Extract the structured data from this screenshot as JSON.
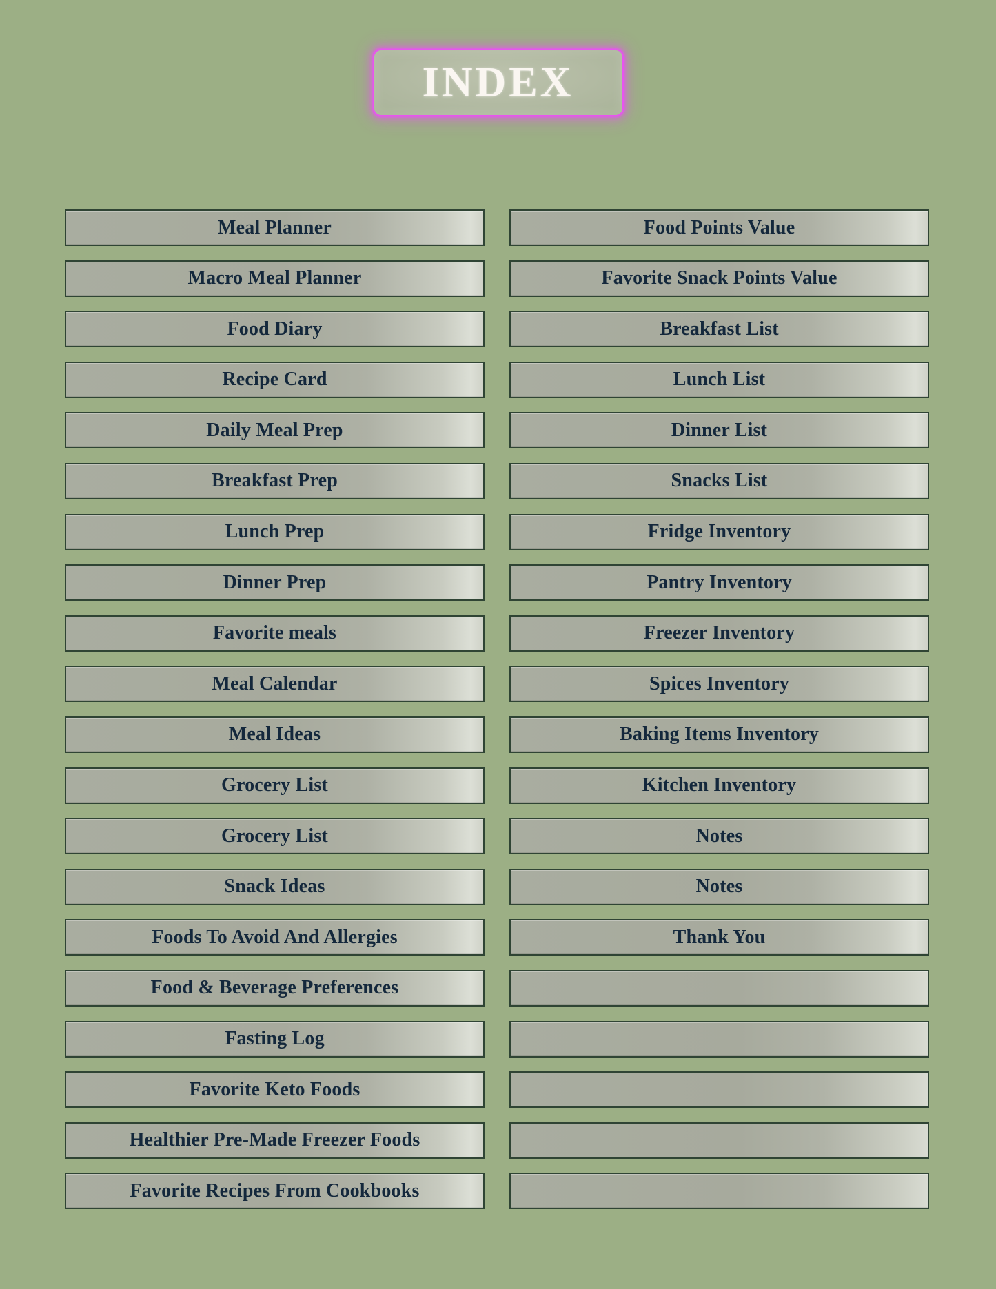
{
  "page": {
    "background_color": "#9caf85",
    "title": "INDEX",
    "title_border_color": "#e854f0",
    "title_text_color": "#faf6f1",
    "entry_fill_color": "#a8ac9c",
    "entry_border_color": "#2f4434",
    "entry_text_color": "#14283c"
  },
  "index": {
    "left_column": [
      {
        "label": "Meal Planner"
      },
      {
        "label": "Macro Meal Planner"
      },
      {
        "label": "Food Diary"
      },
      {
        "label": "Recipe Card"
      },
      {
        "label": "Daily Meal Prep"
      },
      {
        "label": "Breakfast Prep"
      },
      {
        "label": "Lunch Prep"
      },
      {
        "label": "Dinner Prep"
      },
      {
        "label": "Favorite meals"
      },
      {
        "label": "Meal Calendar"
      },
      {
        "label": "Meal Ideas"
      },
      {
        "label": "Grocery List"
      },
      {
        "label": "Grocery List"
      },
      {
        "label": "Snack Ideas"
      },
      {
        "label": "Foods To Avoid And Allergies"
      },
      {
        "label": "Food & Beverage Preferences"
      },
      {
        "label": "Fasting Log"
      },
      {
        "label": "Favorite Keto Foods"
      },
      {
        "label": "Healthier Pre-Made Freezer Foods"
      },
      {
        "label": "Favorite Recipes From Cookbooks"
      }
    ],
    "right_column": [
      {
        "label": "Food Points Value"
      },
      {
        "label": "Favorite Snack Points Value"
      },
      {
        "label": "Breakfast List"
      },
      {
        "label": "Lunch List"
      },
      {
        "label": "Dinner List"
      },
      {
        "label": "Snacks List"
      },
      {
        "label": "Fridge Inventory"
      },
      {
        "label": "Pantry Inventory"
      },
      {
        "label": "Freezer Inventory"
      },
      {
        "label": "Spices Inventory"
      },
      {
        "label": "Baking Items Inventory"
      },
      {
        "label": "Kitchen Inventory"
      },
      {
        "label": "Notes"
      },
      {
        "label": "Notes"
      },
      {
        "label": "Thank You"
      },
      {
        "label": ""
      },
      {
        "label": ""
      },
      {
        "label": ""
      },
      {
        "label": ""
      },
      {
        "label": ""
      }
    ]
  }
}
